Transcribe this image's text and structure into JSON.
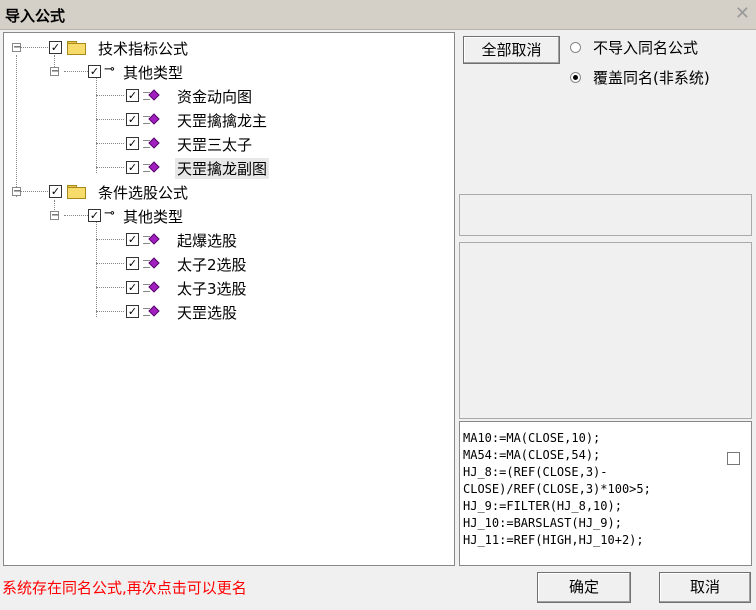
{
  "window": {
    "title": "导入公式",
    "close_symbol": "✕"
  },
  "tree": {
    "groups": [
      {
        "label": "技术指标公式",
        "expanded": true,
        "checked": true,
        "sub": {
          "label": "其他类型",
          "items": [
            "资金动向图",
            "天罡擒擒龙主",
            "天罡三太子",
            "天罡擒龙副图"
          ]
        }
      },
      {
        "label": "条件选股公式",
        "expanded": true,
        "checked": true,
        "sub": {
          "label": "其他类型",
          "items": [
            "起爆选股",
            "太子2选股",
            "太子3选股",
            "天罡选股"
          ]
        }
      }
    ],
    "selected_item": "天罡擒龙副图"
  },
  "controls": {
    "cancel_all_label": "全部取消",
    "option_no_import": "不导入同名公式",
    "option_overwrite": "覆盖同名(非系统)",
    "selected_option": "option_overwrite"
  },
  "code_lines": [
    "MA10:=MA(CLOSE,10);",
    "MA54:=MA(CLOSE,54);",
    "HJ_8:=(REF(CLOSE,3)-",
    "CLOSE)/REF(CLOSE,3)*100>5;",
    "HJ_9:=FILTER(HJ_8,10);",
    "HJ_10:=BARSLAST(HJ_9);",
    "HJ_11:=REF(HIGH,HJ_10+2);"
  ],
  "status_message": "系统存在同名公式,再次点击可以更名",
  "buttons": {
    "ok": "确定",
    "cancel": "取消"
  },
  "colors": {
    "status_text": "#ff0000",
    "gem": "#a01fbf",
    "folder": "#f8dc6b"
  }
}
